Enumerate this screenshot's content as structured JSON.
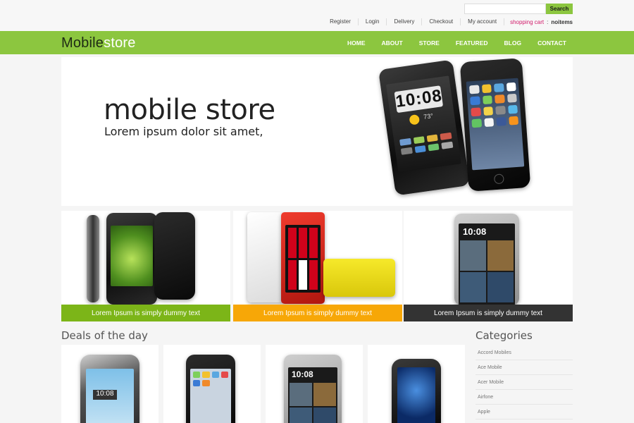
{
  "search": {
    "placeholder": "",
    "button_label": "Search"
  },
  "top_links": {
    "register": "Register",
    "login": "Login",
    "delivery": "Delivery",
    "checkout": "Checkout",
    "my_account": "My account",
    "cart_label": "shopping cart",
    "cart_sep": ":",
    "cart_items": "noitems"
  },
  "logo": {
    "part1": "Mobile",
    "part2": "store"
  },
  "nav": [
    "HOME",
    "ABOUT",
    "STORE",
    "FEATURED",
    "BLOG",
    "CONTACT"
  ],
  "hero": {
    "title": "mobile store",
    "subtitle": "Lorem ipsum dolor sit amet,"
  },
  "hero_phones": {
    "time": "10:08",
    "temp": "73°"
  },
  "promos": [
    {
      "caption": "Lorem Ipsum is simply dummy text",
      "color": "#7cb518"
    },
    {
      "caption": "Lorem Ipsum is simply dummy text",
      "color": "#f7a707"
    },
    {
      "caption": "Lorem Ipsum is simply dummy text",
      "color": "#333333"
    }
  ],
  "promo_phone_time": "10:08",
  "deals": {
    "title": "Deals of the day",
    "time_label": "10:08"
  },
  "categories": {
    "title": "Categories",
    "items": [
      "Accord Mobiles",
      "Ace Mobile",
      "Acer Mobile",
      "Airfone",
      "Apple"
    ]
  },
  "colors": {
    "accent": "#8cc63f",
    "cart": "#d11a6a"
  }
}
